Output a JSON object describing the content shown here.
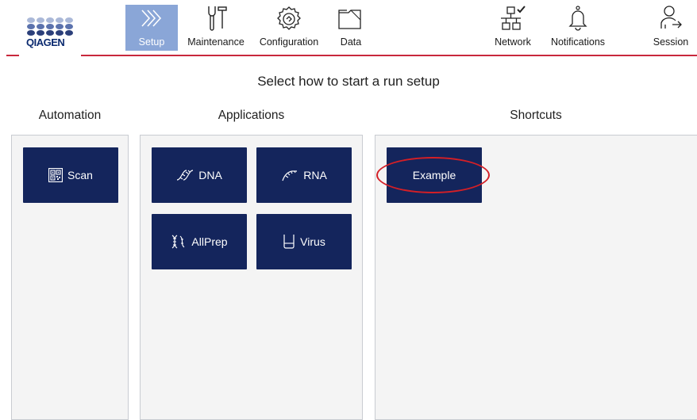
{
  "brand": {
    "logo_text": "QIAGEN",
    "accent": "#c8283c",
    "navy": "#14255c",
    "active_tab": "#8aa6d7"
  },
  "nav": {
    "left": [
      {
        "id": "setup",
        "label": "Setup",
        "icon": "chevrons-right-icon",
        "active": true
      },
      {
        "id": "maintenance",
        "label": "Maintenance",
        "icon": "tools-icon"
      },
      {
        "id": "configuration",
        "label": "Configuration",
        "icon": "gear-icon"
      },
      {
        "id": "data",
        "label": "Data",
        "icon": "folder-icon"
      }
    ],
    "right": [
      {
        "id": "network",
        "label": "Network",
        "icon": "network-icon"
      },
      {
        "id": "notifications",
        "label": "Notifications",
        "icon": "bell-icon"
      },
      {
        "id": "session",
        "label": "Session",
        "icon": "user-logout-icon"
      }
    ]
  },
  "main": {
    "subtitle": "Select how to start a run setup",
    "columns": {
      "automation": {
        "title": "Automation",
        "buttons": [
          {
            "label": "Scan",
            "icon": "qr-code-icon"
          }
        ]
      },
      "applications": {
        "title": "Applications",
        "buttons": [
          {
            "label": "DNA",
            "icon": "dna-icon"
          },
          {
            "label": "RNA",
            "icon": "rna-icon"
          },
          {
            "label": "AllPrep",
            "icon": "allprep-icon"
          },
          {
            "label": "Virus",
            "icon": "tube-icon"
          }
        ]
      },
      "shortcuts": {
        "title": "Shortcuts",
        "buttons": [
          {
            "label": "Example",
            "highlighted": true
          }
        ]
      }
    }
  }
}
